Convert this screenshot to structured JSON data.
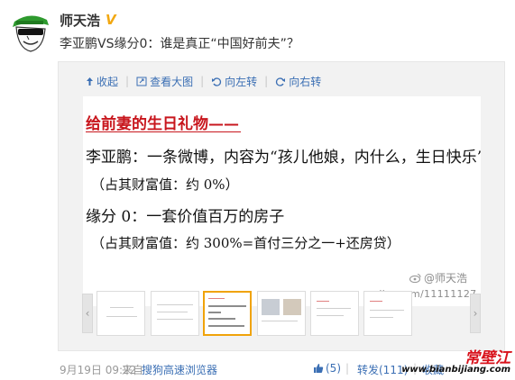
{
  "author": {
    "name": "师天浩",
    "verified_badge": "V"
  },
  "post": {
    "text": "李亚鹏VS缘分0：谁是真正“中国好前夫”？"
  },
  "toolbar": {
    "items": [
      {
        "label": "收起",
        "icon": "collapse-up-arrow-icon"
      },
      {
        "label": "查看大图",
        "icon": "expand-view-icon"
      },
      {
        "label": "向左转",
        "icon": "rotate-left-icon"
      },
      {
        "label": "向右转",
        "icon": "rotate-right-icon"
      }
    ]
  },
  "image": {
    "title": "给前妻的生日礼物——",
    "line2": "李亚鹏：一条微博，内容为“孩儿他娘，内什么，生日快乐”",
    "line3": "（占其财富值：约 0%）",
    "line4": "缘分 0：一套价值百万的房子",
    "line5": "（占其财富值：约 300%=首付三分之一+还房贷）",
    "watermark_handle": "@师天浩",
    "watermark_url": "weibo.com/11111127"
  },
  "thumbnails": {
    "count": 6,
    "active_index": 2
  },
  "footer": {
    "time": "9月19日 09:22",
    "source_prefix": "来自",
    "source": "搜狗高速浏览器",
    "like_count": "(5)",
    "repost": "转发(111)",
    "comment_partial": "收藏",
    "link_color": "#3b6fb4"
  },
  "logo_watermark": {
    "chars": "常壁江",
    "url": "www.bianbijiang.com"
  }
}
